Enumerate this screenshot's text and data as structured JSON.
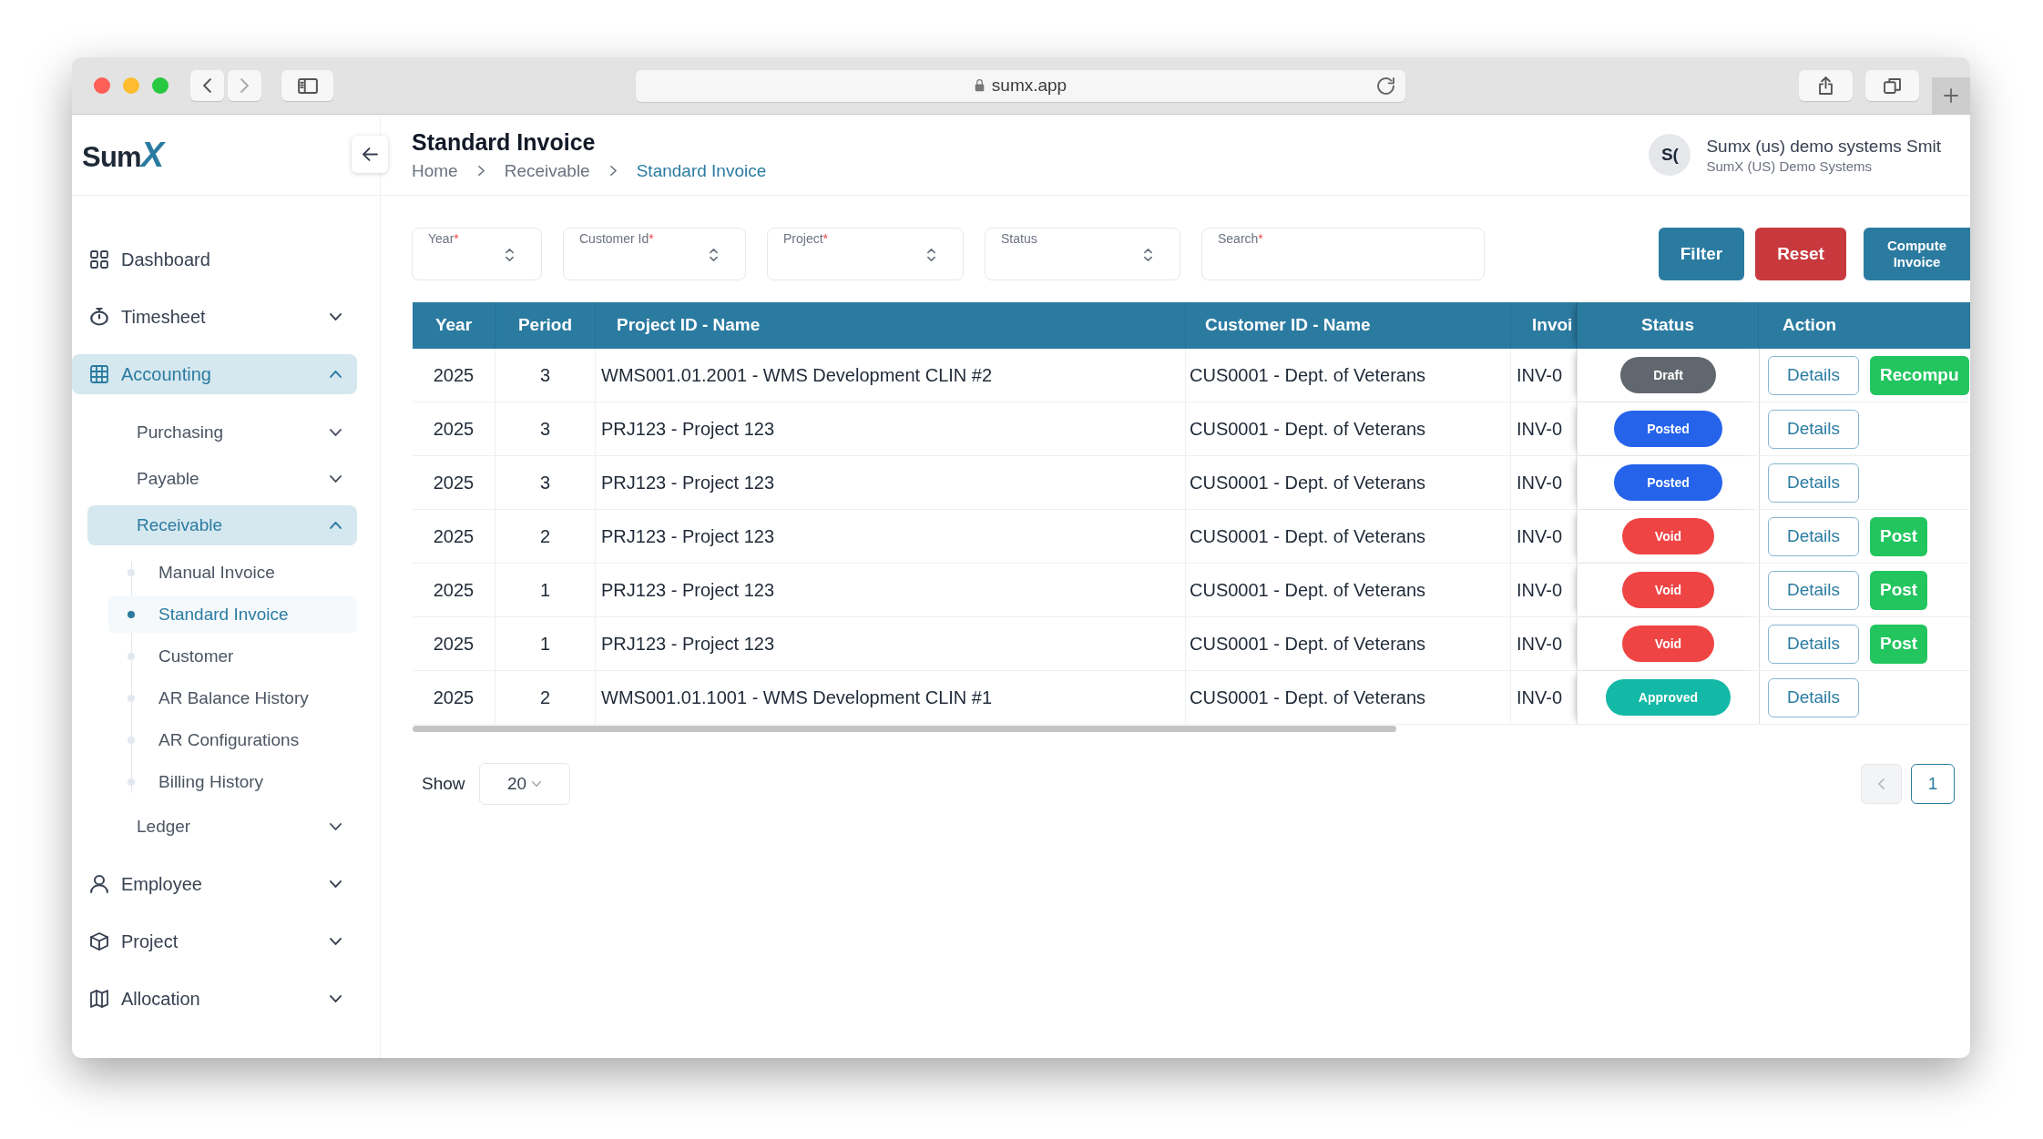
{
  "browser": {
    "url": "sumx.app"
  },
  "sidebar": {
    "logo": "SumX",
    "items": [
      {
        "label": "Dashboard",
        "selected": false
      },
      {
        "label": "Timesheet",
        "selected": false,
        "expanded": false
      },
      {
        "label": "Accounting",
        "selected": true,
        "expanded": true,
        "children": [
          {
            "label": "Purchasing",
            "selected": false,
            "expanded": false
          },
          {
            "label": "Payable",
            "selected": false,
            "expanded": false
          },
          {
            "label": "Receivable",
            "selected": true,
            "expanded": true,
            "children": [
              {
                "label": "Manual Invoice",
                "selected": false
              },
              {
                "label": "Standard Invoice",
                "selected": true
              },
              {
                "label": "Customer",
                "selected": false
              },
              {
                "label": "AR Balance History",
                "selected": false
              },
              {
                "label": "AR Configurations",
                "selected": false
              },
              {
                "label": "Billing History",
                "selected": false
              }
            ]
          },
          {
            "label": "Ledger",
            "selected": false,
            "expanded": false
          }
        ]
      },
      {
        "label": "Employee",
        "selected": false,
        "expanded": false
      },
      {
        "label": "Project",
        "selected": false,
        "expanded": false
      },
      {
        "label": "Allocation",
        "selected": false,
        "expanded": false
      }
    ]
  },
  "header": {
    "title": "Standard Invoice",
    "breadcrumb": [
      {
        "label": "Home",
        "selected": false
      },
      {
        "label": "Receivable",
        "selected": false
      },
      {
        "label": "Standard Invoice",
        "selected": true
      }
    ],
    "user": {
      "initials": "S(",
      "name": "Sumx (us) demo systems Smit",
      "organization": "SumX (US) Demo Systems"
    }
  },
  "filters": [
    {
      "kind": "select",
      "label": "Year",
      "required_mark": "*"
    },
    {
      "kind": "select",
      "label": "Customer Id",
      "required_mark": "*"
    },
    {
      "kind": "select",
      "label": "Project",
      "required_mark": "*"
    },
    {
      "kind": "select",
      "label": "Status"
    },
    {
      "kind": "input",
      "label": "Search",
      "required_mark": "*"
    }
  ],
  "actions": [
    {
      "kind": "primary",
      "label": "Filter"
    },
    {
      "kind": "danger",
      "label": "Reset"
    },
    {
      "kind": "compact",
      "label": "Compute Invoice"
    }
  ],
  "table": {
    "columns": [
      "Year",
      "Period",
      "Project ID - Name",
      "Customer ID - Name",
      "Invoi",
      "Status",
      "Action"
    ],
    "rows": [
      {
        "cells": [
          "2025",
          "3",
          "WMS001.01.2001 - WMS Development CLIN #2",
          "CUS0001 - Dept. of Veterans",
          "INV-0"
        ],
        "status": {
          "label": "Draft",
          "color": "#61676f"
        },
        "actions": [
          {
            "kind": "outline",
            "label": "Details"
          },
          {
            "kind": "solid",
            "label": "Recompu"
          }
        ]
      },
      {
        "cells": [
          "2025",
          "3",
          "PRJ123 - Project 123",
          "CUS0001 - Dept. of Veterans",
          "INV-0"
        ],
        "status": {
          "label": "Posted",
          "color": "#2563eb"
        },
        "actions": [
          {
            "kind": "outline",
            "label": "Details"
          }
        ]
      },
      {
        "cells": [
          "2025",
          "3",
          "PRJ123 - Project 123",
          "CUS0001 - Dept. of Veterans",
          "INV-0"
        ],
        "status": {
          "label": "Posted",
          "color": "#2563eb"
        },
        "actions": [
          {
            "kind": "outline",
            "label": "Details"
          }
        ]
      },
      {
        "cells": [
          "2025",
          "2",
          "PRJ123 - Project 123",
          "CUS0001 - Dept. of Veterans",
          "INV-0"
        ],
        "status": {
          "label": "Void",
          "color": "#ef4444"
        },
        "actions": [
          {
            "kind": "outline",
            "label": "Details"
          },
          {
            "kind": "solid",
            "label": "Post"
          }
        ]
      },
      {
        "cells": [
          "2025",
          "1",
          "PRJ123 - Project 123",
          "CUS0001 - Dept. of Veterans",
          "INV-0"
        ],
        "status": {
          "label": "Void",
          "color": "#ef4444"
        },
        "actions": [
          {
            "kind": "outline",
            "label": "Details"
          },
          {
            "kind": "solid",
            "label": "Post"
          }
        ]
      },
      {
        "cells": [
          "2025",
          "1",
          "PRJ123 - Project 123",
          "CUS0001 - Dept. of Veterans",
          "INV-0"
        ],
        "status": {
          "label": "Void",
          "color": "#ef4444"
        },
        "actions": [
          {
            "kind": "outline",
            "label": "Details"
          },
          {
            "kind": "solid",
            "label": "Post"
          }
        ]
      },
      {
        "cells": [
          "2025",
          "2",
          "WMS001.01.1001 - WMS Development CLIN #1",
          "CUS0001 - Dept. of Veterans",
          "INV-0"
        ],
        "status": {
          "label": "Approved",
          "color": "#14b8a6"
        },
        "actions": [
          {
            "kind": "outline",
            "label": "Details"
          }
        ]
      }
    ]
  },
  "pagination": {
    "show_label": "Show",
    "page_size": "20",
    "pages": [
      {
        "label": "1",
        "selected": true
      }
    ]
  }
}
